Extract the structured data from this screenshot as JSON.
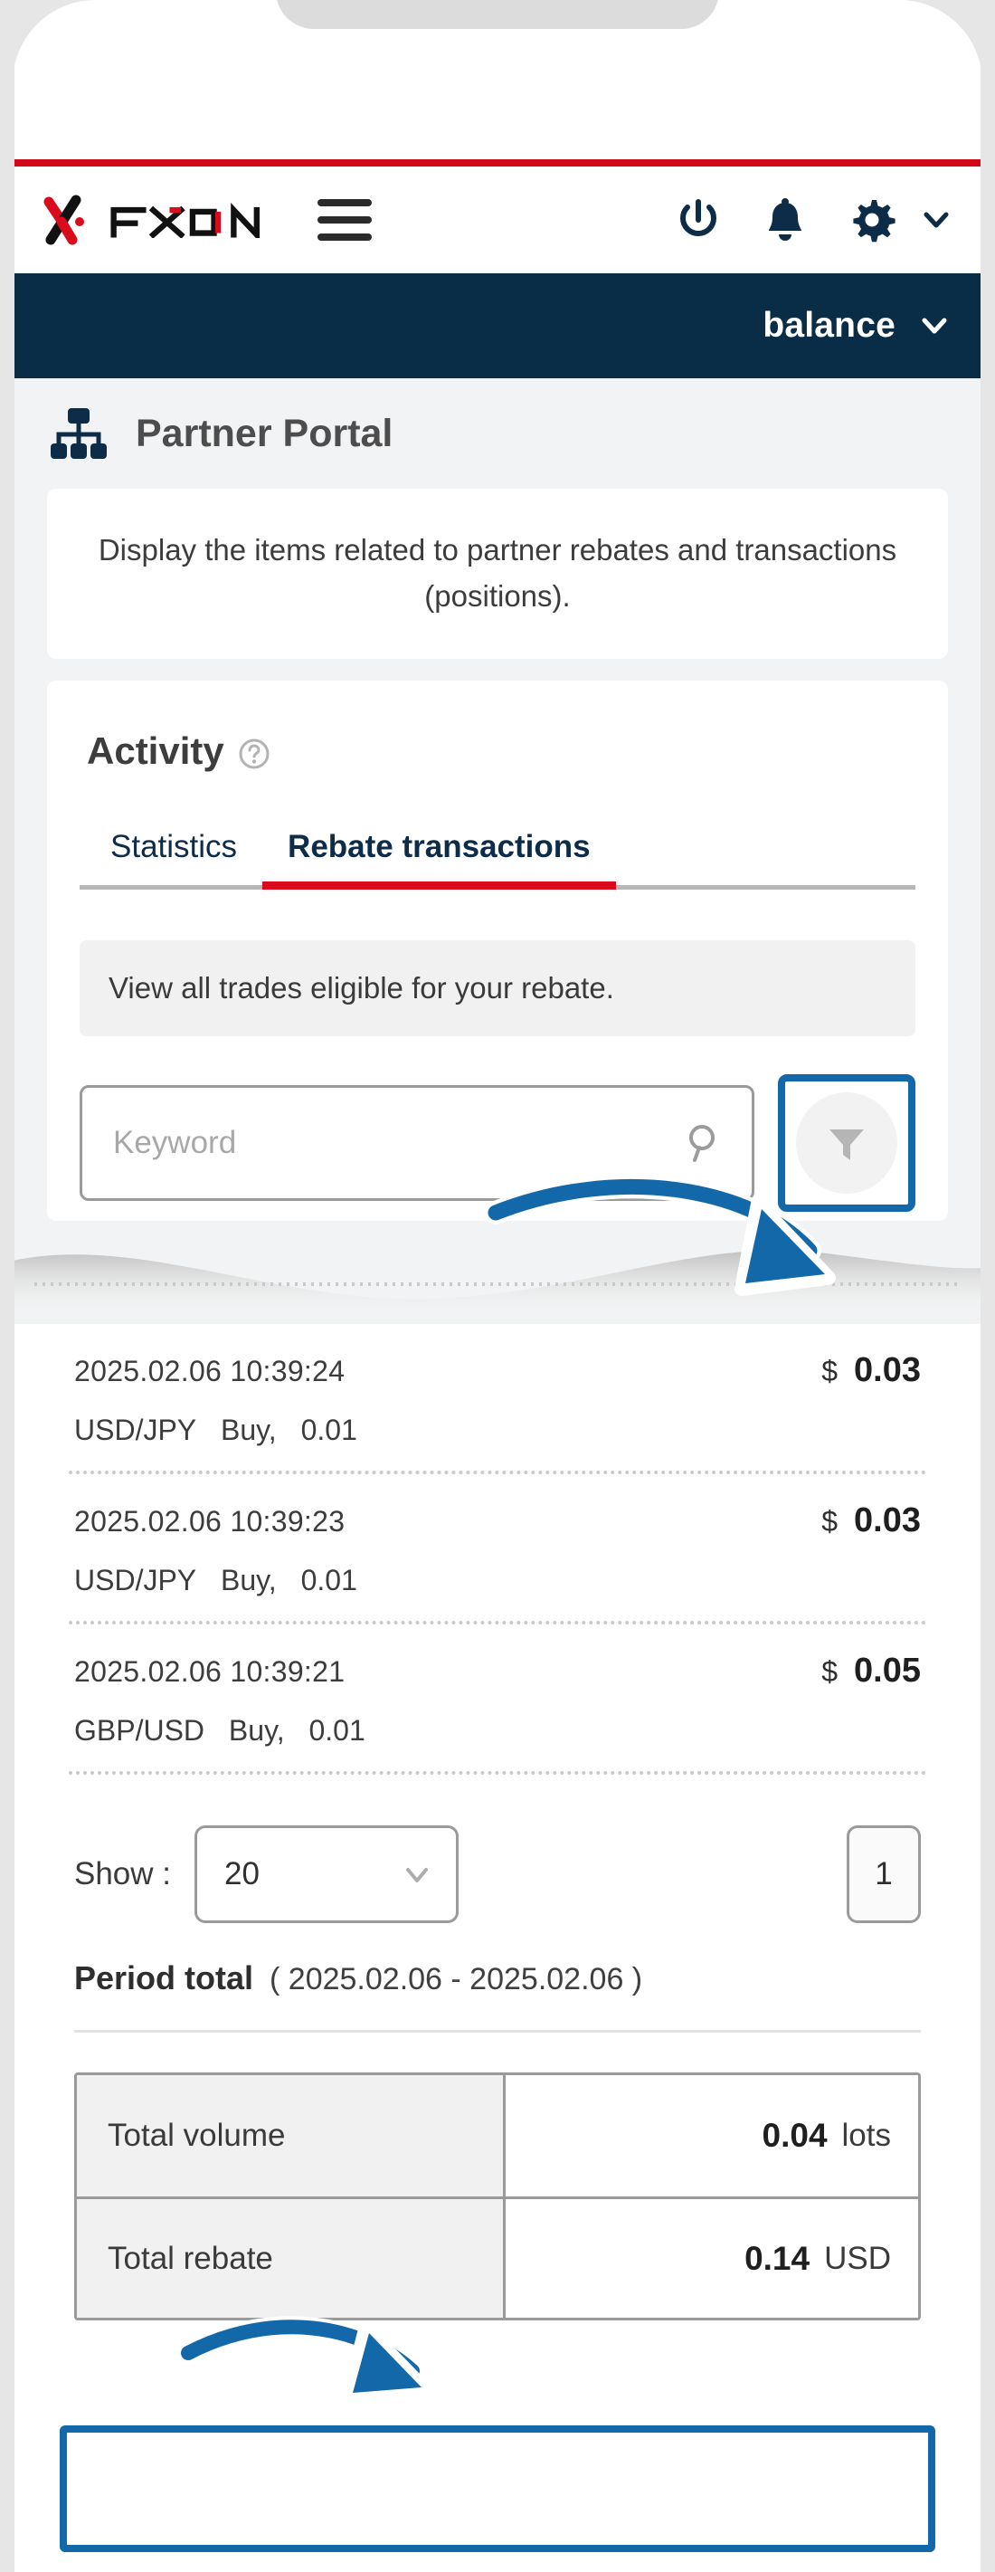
{
  "header": {
    "logo_text": "FXON",
    "icons": [
      "power-icon",
      "bell-icon",
      "gear-icon",
      "chevron-down-icon"
    ],
    "menu_icon": "hamburger-menu-icon"
  },
  "balance_bar": {
    "label": "balance",
    "chevron": "chevron-down-icon"
  },
  "portal": {
    "icon": "sitemap-icon",
    "title": "Partner Portal",
    "description": "Display the items related to partner rebates and transactions (positions)."
  },
  "activity": {
    "title": "Activity",
    "help_icon": "help-circle-icon",
    "tabs": [
      {
        "label": "Statistics",
        "active": false
      },
      {
        "label": "Rebate transactions",
        "active": true
      }
    ],
    "hint": "View all trades eligible for your rebate.",
    "search": {
      "placeholder": "Keyword",
      "value": "",
      "search_icon": "search-icon",
      "filter_icon": "filter-funnel-icon"
    }
  },
  "transactions": [
    {
      "datetime": "2025.02.06 10:39:24",
      "currency_symbol": "$",
      "amount": "0.03",
      "symbol": "USD/JPY",
      "side": "Buy,",
      "lots": "0.01"
    },
    {
      "datetime": "2025.02.06 10:39:23",
      "currency_symbol": "$",
      "amount": "0.03",
      "symbol": "USD/JPY",
      "side": "Buy,",
      "lots": "0.01"
    },
    {
      "datetime": "2025.02.06 10:39:21",
      "currency_symbol": "$",
      "amount": "0.05",
      "symbol": "GBP/USD",
      "side": "Buy,",
      "lots": "0.01"
    }
  ],
  "pagination": {
    "show_label": "Show :",
    "show_value": "20",
    "page_current": "1"
  },
  "period_total": {
    "label": "Period total",
    "range": "( 2025.02.06 - 2025.02.06 )",
    "rows": [
      {
        "key": "Total volume",
        "value": "0.04",
        "unit": "lots"
      },
      {
        "key": "Total rebate",
        "value": "0.14",
        "unit": "USD"
      }
    ]
  },
  "colors": {
    "brand_red": "#d90b1c",
    "navy": "#092c47",
    "annotation_blue": "#1268a8",
    "page_bg": "#f2f3f4"
  }
}
